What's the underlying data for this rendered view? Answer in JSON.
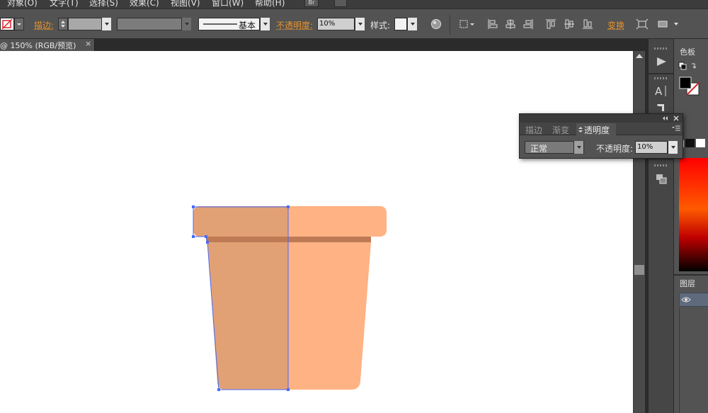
{
  "menu": {
    "items": [
      "对象(O)",
      "文字(T)",
      "选择(S)",
      "效果(C)",
      "视图(V)",
      "窗口(W)",
      "帮助(H)"
    ],
    "bridge_label": "Br"
  },
  "control_bar": {
    "stroke_label": "描边:",
    "stroke_profile_label": "基本",
    "opacity_label": "不透明度:",
    "opacity_value": "10%",
    "style_label": "样式:",
    "transform_label": "变换"
  },
  "document_tab": {
    "title": "@ 150% (RGB/预览)",
    "close": "×"
  },
  "right_dock": {
    "color_tab": "色板",
    "layers_tab": "图层"
  },
  "transparency_panel": {
    "tabs": [
      "描边",
      "渐变",
      "透明度"
    ],
    "active_tab": "透明度",
    "blend_mode": "正常",
    "opacity_label": "不透明度:",
    "opacity_value": "10%"
  },
  "colors": {
    "ui_dark": "#323232",
    "ui_mid": "#535353",
    "accent_orange": "#e8932b",
    "pot_left": "#e2a175",
    "pot_right": "#ffb283",
    "pot_band": "#be7a55",
    "selection": "#4a6cf7"
  }
}
